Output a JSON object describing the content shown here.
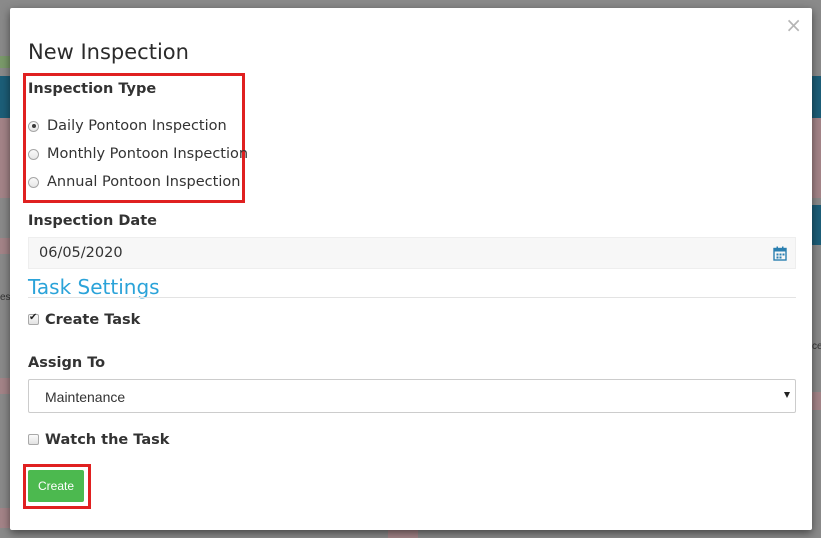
{
  "dialog": {
    "title": "New Inspection",
    "close_symbol": "×"
  },
  "inspection_type": {
    "label": "Inspection Type",
    "options": [
      {
        "label": "Daily Pontoon Inspection",
        "checked": true
      },
      {
        "label": "Monthly Pontoon Inspection",
        "checked": false
      },
      {
        "label": "Annual Pontoon Inspection",
        "checked": false
      }
    ]
  },
  "inspection_date": {
    "label": "Inspection Date",
    "value": "06/05/2020",
    "icon": "calendar-icon"
  },
  "task_settings": {
    "title": "Task Settings",
    "create_task": {
      "label": "Create Task",
      "checked": true
    },
    "assign_to": {
      "label": "Assign To",
      "value": "Maintenance"
    },
    "watch_task": {
      "label": "Watch the Task",
      "checked": false
    }
  },
  "actions": {
    "create_label": "Create"
  },
  "colors": {
    "accent": "#2ba3d9",
    "create_button": "#4cb94f",
    "highlight": "#e02020",
    "backdrop": "#8a8a8a"
  },
  "background_fragments": {
    "left_text": "es",
    "right_text": "ce"
  }
}
